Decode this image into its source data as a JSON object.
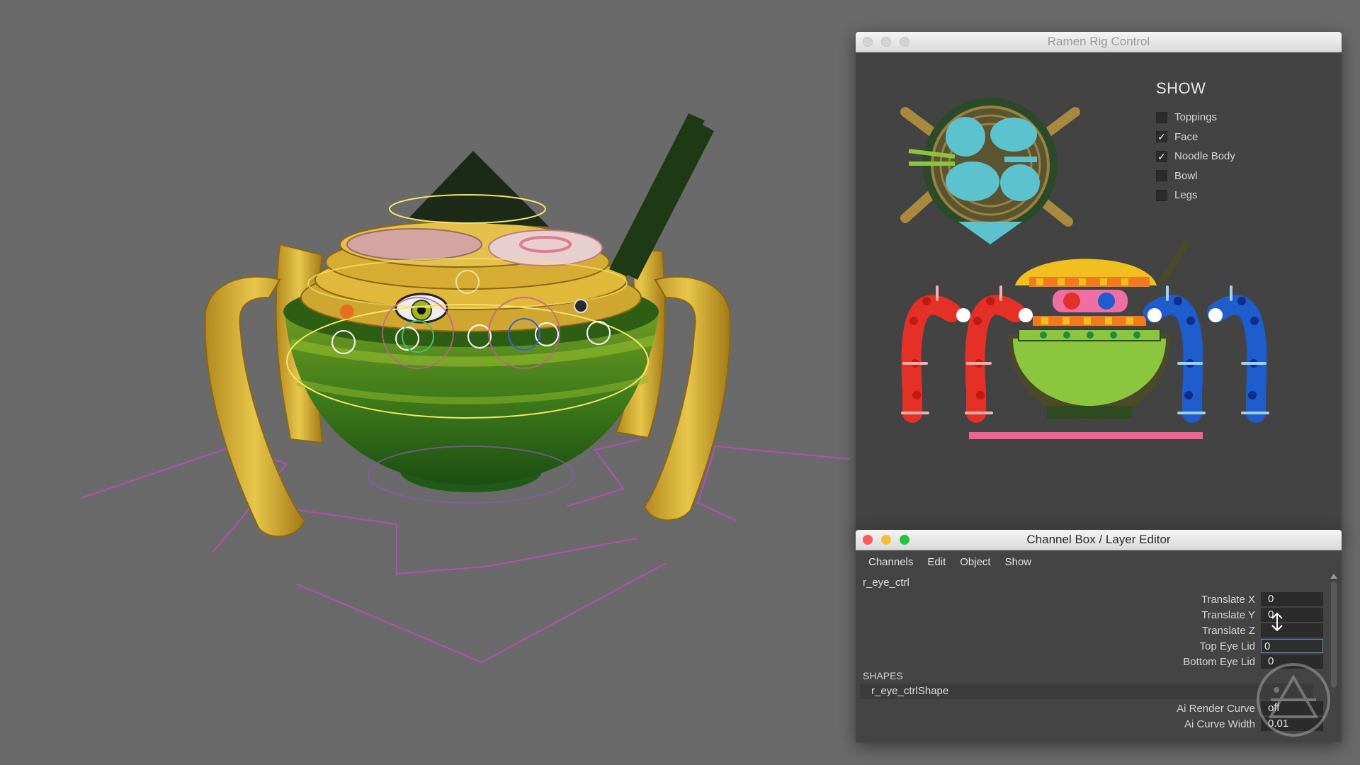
{
  "viewport": {
    "background": "#6a6a6a",
    "model": "noodle-bowl-spider"
  },
  "rig_window": {
    "title": "Ramen Rig Control",
    "show_title": "SHOW",
    "options": [
      {
        "label": "Toppings",
        "checked": false
      },
      {
        "label": "Face",
        "checked": true
      },
      {
        "label": "Noodle Body",
        "checked": true
      },
      {
        "label": "Bowl",
        "checked": false
      },
      {
        "label": "Legs",
        "checked": false
      }
    ],
    "check_glyph": "✓",
    "colors": {
      "left_legs": "#e53028",
      "right_legs": "#1f5ccc",
      "bowl": "#8cc63f",
      "noodles": "#f2c01e",
      "eyes": "#ef6fa4",
      "toppings": "#5bc2ce",
      "floor_bar": "#f06292"
    }
  },
  "channel_box": {
    "title": "Channel Box / Layer Editor",
    "menu": [
      "Channels",
      "Edit",
      "Object",
      "Show"
    ],
    "object_name": "r_eye_ctrl",
    "attributes": [
      {
        "label": "Translate X",
        "value": "0"
      },
      {
        "label": "Translate Y",
        "value": "0"
      },
      {
        "label": "Translate Z",
        "value": ""
      },
      {
        "label": "Top Eye Lid",
        "value": "0"
      },
      {
        "label": "Bottom Eye Lid",
        "value": "0"
      }
    ],
    "shapes_header": "SHAPES",
    "shape_name": "r_eye_ctrlShape",
    "shape_attributes": [
      {
        "label": "Ai Render Curve",
        "value": "off"
      },
      {
        "label": "Ai Curve Width",
        "value": "0.01"
      }
    ]
  }
}
